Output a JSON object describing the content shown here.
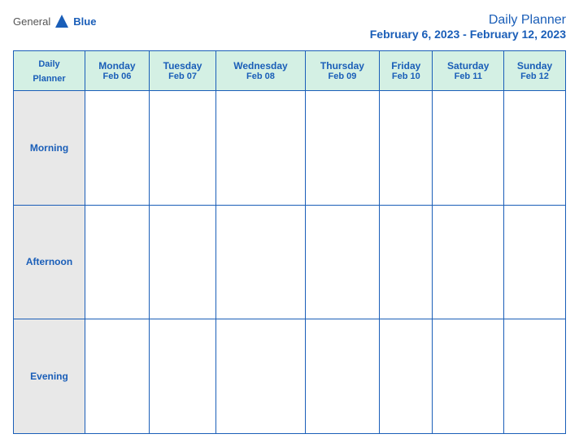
{
  "header": {
    "logo": {
      "general": "General",
      "blue": "Blue",
      "icon_unicode": "▶"
    },
    "title_line1": "Daily Planner",
    "title_line2": "February 6, 2023 - February 12, 2023"
  },
  "columns": [
    {
      "day": "Daily Planner",
      "date": ""
    },
    {
      "day": "Monday",
      "date": "Feb 06"
    },
    {
      "day": "Tuesday",
      "date": "Feb 07"
    },
    {
      "day": "Wednesday",
      "date": "Feb 08"
    },
    {
      "day": "Thursday",
      "date": "Feb 09"
    },
    {
      "day": "Friday",
      "date": "Feb 10"
    },
    {
      "day": "Saturday",
      "date": "Feb 11"
    },
    {
      "day": "Sunday",
      "date": "Feb 12"
    }
  ],
  "rows": [
    {
      "label": "Morning"
    },
    {
      "label": "Afternoon"
    },
    {
      "label": "Evening"
    }
  ]
}
